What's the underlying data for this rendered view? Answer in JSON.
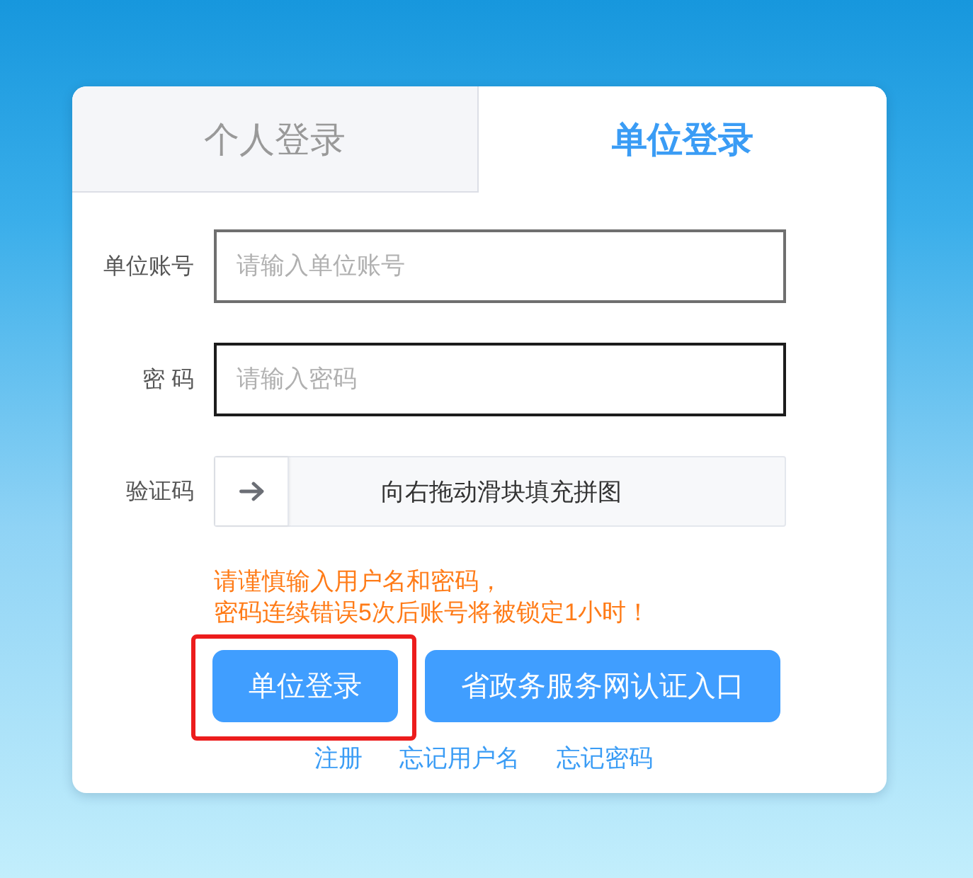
{
  "tabs": [
    {
      "label": "个人登录",
      "selected": false
    },
    {
      "label": "单位登录",
      "selected": true
    }
  ],
  "fields": [
    {
      "kind": "text",
      "label": "单位账号",
      "placeholder": "请输入单位账号",
      "focused": false
    },
    {
      "kind": "password",
      "label": "密 码",
      "placeholder": "请输入密码",
      "focused": true
    },
    {
      "kind": "slider",
      "label": "验证码",
      "hint": "向右拖动滑块填充拼图",
      "level": 0
    }
  ],
  "warning": [
    "请谨慎输入用户名和密码，",
    "密码连续错误5次后账号将被锁定1小时！"
  ],
  "buttons": [
    {
      "label": "单位登录",
      "highlighted": true
    },
    {
      "label": "省政务服务网认证入口",
      "highlighted": false
    }
  ],
  "links": [
    "注册",
    "忘记用户名",
    "忘记密码"
  ]
}
